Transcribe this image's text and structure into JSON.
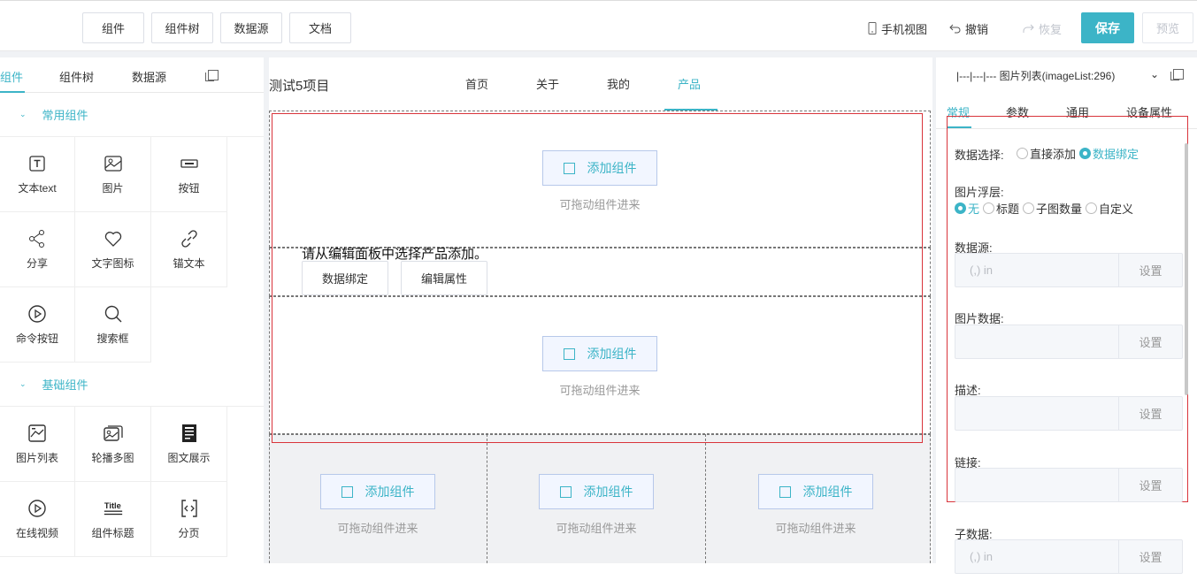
{
  "toolbar": {
    "buttons": [
      "组件",
      "组件树",
      "数据源",
      "文档"
    ],
    "mobile_view": "手机视图",
    "undo": "撤销",
    "redo": "恢复",
    "save": "保存",
    "preview": "预览"
  },
  "left_panel": {
    "tabs": [
      "组件",
      "组件树",
      "数据源"
    ],
    "active_tab": 0,
    "groups": [
      {
        "title": "常用组件",
        "items": [
          {
            "label": "文本text",
            "icon": "text-icon"
          },
          {
            "label": "图片",
            "icon": "image-icon"
          },
          {
            "label": "按钮",
            "icon": "button-icon"
          },
          {
            "label": "分享",
            "icon": "share-icon"
          },
          {
            "label": "文字图标",
            "icon": "heart-icon"
          },
          {
            "label": "锚文本",
            "icon": "link-icon"
          },
          {
            "label": "命令按钮",
            "icon": "play-circle-icon"
          },
          {
            "label": "搜索框",
            "icon": "search-icon"
          }
        ]
      },
      {
        "title": "基础组件",
        "items": [
          {
            "label": "图片列表",
            "icon": "image-list-icon"
          },
          {
            "label": "轮播多图",
            "icon": "carousel-icon"
          },
          {
            "label": "图文展示",
            "icon": "article-icon"
          },
          {
            "label": "在线视频",
            "icon": "video-icon"
          },
          {
            "label": "组件标题",
            "icon": "title-icon"
          },
          {
            "label": "分页",
            "icon": "pagination-icon"
          }
        ]
      }
    ]
  },
  "canvas": {
    "project_title": "测试5项目",
    "nav": [
      "首页",
      "关于",
      "我的",
      "产品"
    ],
    "active_nav": 3,
    "add_component": "添加组件",
    "drag_hint": "可拖动组件进来",
    "product_message": "请从编辑面板中选择产品添加。",
    "bind_data": "数据绑定",
    "edit_props": "编辑属性"
  },
  "right_panel": {
    "header": "|---|---|--- 图片列表(imageList:296)",
    "tabs": [
      "常规",
      "参数",
      "通用",
      "设备属性"
    ],
    "active_tab": 0,
    "data_select": {
      "label": "数据选择:",
      "options": [
        "直接添加",
        "数据绑定"
      ],
      "selected": 1
    },
    "image_overlay": {
      "label": "图片浮层:",
      "options": [
        "无",
        "标题",
        "子图数量",
        "自定义"
      ],
      "selected": 0
    },
    "fields": [
      {
        "label": "数据源:",
        "placeholder": "(,) in",
        "button": "设置"
      },
      {
        "label": "图片数据:",
        "placeholder": "",
        "button": "设置"
      },
      {
        "label": "描述:",
        "placeholder": "",
        "button": "设置"
      },
      {
        "label": "链接:",
        "placeholder": "",
        "button": "设置"
      },
      {
        "label": "子数据:",
        "placeholder": "(,) in",
        "button": "设置"
      }
    ]
  },
  "colors": {
    "accent": "#3cb4c7",
    "selection_border": "#d9343b"
  }
}
